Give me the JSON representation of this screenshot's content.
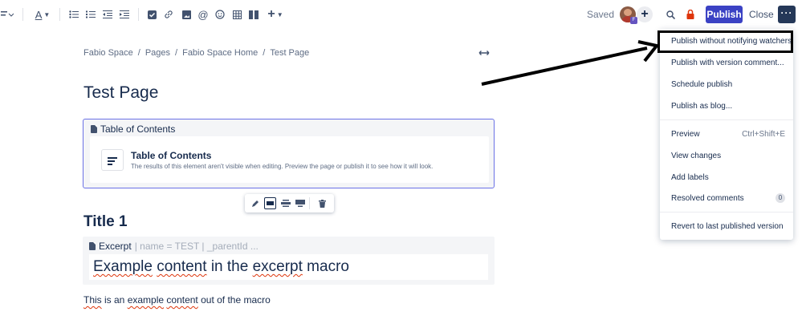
{
  "toolbar": {
    "saved": "Saved",
    "avatar_badge": "F",
    "publish": "Publish",
    "close": "Close",
    "more": "···"
  },
  "breadcrumb": [
    "Fabio Space",
    "Pages",
    "Fabio Space Home",
    "Test Page"
  ],
  "page_title": "Test Page",
  "toc_macro": {
    "label": "Table of Contents",
    "card_title": "Table of Contents",
    "card_desc": "The results of this element aren't visible when editing. Preview the page or publish it to see how it will look."
  },
  "heading1": "Title 1",
  "excerpt_macro": {
    "label": "Excerpt",
    "params": "| name = TEST | _parentId ...",
    "content_words": [
      "Example",
      "content",
      "in the",
      "excerpt",
      "macro"
    ]
  },
  "paragraph": {
    "w1": "This",
    "w2": " is an ",
    "w3": "example",
    "w4": " ",
    "w5": "content",
    "w6": " out of the macro"
  },
  "publish_menu": {
    "items": [
      {
        "label": "Publish without notifying watchers"
      },
      {
        "label": "Publish with version comment..."
      },
      {
        "label": "Schedule publish"
      },
      {
        "label": "Publish as blog..."
      },
      {
        "label": "Preview",
        "shortcut": "Ctrl+Shift+E"
      },
      {
        "label": "View changes"
      },
      {
        "label": "Add labels"
      },
      {
        "label": "Resolved comments",
        "badge": "0"
      },
      {
        "label": "Revert to last published version"
      }
    ]
  },
  "colors": {
    "publish": "#3b42c4",
    "accent_border": "#6b72e6",
    "annotation": "#000000"
  }
}
